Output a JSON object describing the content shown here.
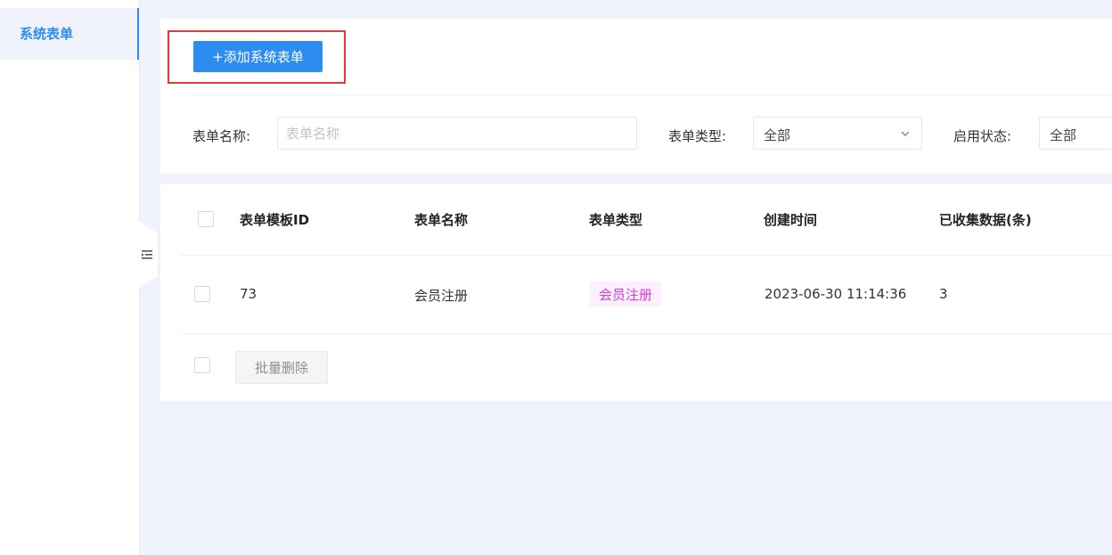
{
  "sidebar": {
    "items": [
      {
        "label": "系统表单",
        "active": true
      }
    ]
  },
  "toolbar": {
    "add_label": "+添加系统表单"
  },
  "filters": {
    "name_label": "表单名称:",
    "name_placeholder": "表单名称",
    "type_label": "表单类型:",
    "type_value": "全部",
    "status_label": "启用状态:",
    "status_value": "全部"
  },
  "table": {
    "columns": [
      "表单模板ID",
      "表单名称",
      "表单类型",
      "创建时间",
      "已收集数据(条)"
    ],
    "rows": [
      {
        "id": "73",
        "name": "会员注册",
        "type": "会员注册",
        "created": "2023-06-30 11:14:36",
        "count": "3"
      }
    ],
    "batch_delete_label": "批量删除"
  },
  "colors": {
    "accent": "#2d8cf0",
    "tag_text": "#d63ad8",
    "tag_bg": "#fdf0fd",
    "highlight": "#e53935"
  },
  "icons": {
    "collapse": "collapse-sidebar-icon",
    "dropdown": "chevron-down-icon"
  }
}
